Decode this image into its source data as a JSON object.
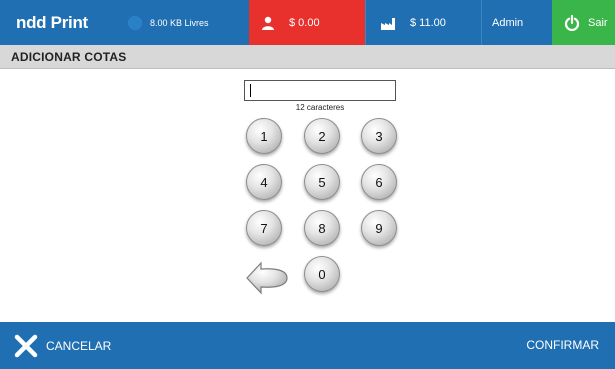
{
  "header": {
    "logo": "ndd Print",
    "storage": "8.00 KB Livres",
    "balance": "$ 0.00",
    "quota": "$ 11.00",
    "user": "Admin",
    "exit": "Sair",
    "colors": {
      "bar": "#1f6fb2",
      "balance_bg": "#e8302c",
      "exit_bg": "#3ab54a"
    }
  },
  "page_title": "ADICIONAR COTAS",
  "input": {
    "value": "",
    "hint": "12 caracteres"
  },
  "keypad": {
    "k1": "1",
    "k2": "2",
    "k3": "3",
    "k4": "4",
    "k5": "5",
    "k6": "6",
    "k7": "7",
    "k8": "8",
    "k9": "9",
    "k0": "0"
  },
  "footer": {
    "cancel": "CANCELAR",
    "confirm": "CONFIRMAR"
  },
  "icons": [
    "storage-icon",
    "user-icon",
    "factory-icon",
    "power-icon",
    "backspace-icon",
    "close-icon"
  ]
}
